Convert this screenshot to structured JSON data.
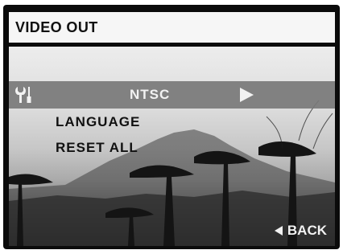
{
  "header": {
    "title": "VIDEO OUT"
  },
  "menu": {
    "selected": {
      "value": "NTSC"
    },
    "items": [
      {
        "label": "LANGUAGE"
      },
      {
        "label": "RESET ALL"
      }
    ]
  },
  "footer": {
    "back_label": "BACK"
  },
  "icons": {
    "settings": "settings-tools-icon",
    "arrow": "play-arrow-right-icon",
    "back": "back-arrow-left-icon"
  }
}
